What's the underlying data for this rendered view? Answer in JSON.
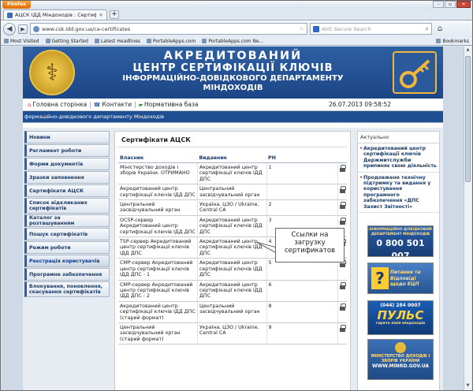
{
  "browser": {
    "menu_label": "Firefox",
    "tab_title": "АЦСК ІДД Міндоходів : Сертифікати А...",
    "tab_close": "×",
    "new_tab": "+",
    "url": "www.csk.idd.gov.ua/ca-certificates",
    "search_placeholder": "AVG Secure Search",
    "bookmarks": [
      "Most Visited",
      "Getting Started",
      "Latest Headlines",
      "PortableApps.com",
      "PortableApps.com Ne..."
    ],
    "bookmarks_menu": "Bookmarks"
  },
  "header": {
    "line1": "АКРЕДИТОВАНИЙ",
    "line2": "ЦЕНТР СЕРТИФІКАЦІЇ КЛЮЧІВ",
    "line3": "ІНФОРМАЦІЙНО-ДОВІДКОВОГО ДЕПАРТАМЕНТУ",
    "line4": "МІНДОХОДІВ"
  },
  "top_links": {
    "home": "Головна сторінка",
    "contacts": "Контакти",
    "regulatory": "Нормативна база",
    "datetime": "26.07.2013 09:58:52",
    "separator": "|"
  },
  "subbar": "формаційно-довідкового департаменту Міндоходів",
  "left_nav": [
    {
      "label": "Новини"
    },
    {
      "label": "Регламент роботи"
    },
    {
      "label": "Форми документів"
    },
    {
      "label": "Зразки заповнення"
    },
    {
      "label": "Сертифікати АЦСК"
    },
    {
      "label": "Список відкликаних сертифікатів"
    },
    {
      "label": "Каталог за розташуванням"
    },
    {
      "label": "Пошук сертифікатів"
    },
    {
      "label": "Режим роботи"
    },
    {
      "label": "Реєстрація користувачів"
    },
    {
      "label": "Програмне забезпечення"
    },
    {
      "label": "Блокування, поновлення, скасування сертифікатів"
    }
  ],
  "content": {
    "title": "Сертифікати АЦСК",
    "headers": [
      "Власник",
      "Видавник",
      "РН"
    ],
    "rows": [
      {
        "owner": "Міністерство доходів і зборів України. ОТРИМАНО",
        "issuer": "Акредитований центр сертифікації ключів ІДД ДПС",
        "rn": "1"
      },
      {
        "owner": "Акредитований центр сертифікації ключів ІДД ДПС",
        "issuer": "Центральний засвідчувальний орган",
        "rn": ""
      },
      {
        "owner": "Центральний засвідчувальний орган",
        "issuer": "Україна, ЦЗО / Ukraine, Central CA",
        "rn": "2"
      },
      {
        "owner": "OCSP-сервер Акредитований центр сертифікації ключів ІДД ДПС",
        "issuer": "Акредитований центр сертифікації ключів ІДД ДПС",
        "rn": "3"
      },
      {
        "owner": "TSP-сервер Акредитований центр сертифікації ключів ІДД ДПС",
        "issuer": "Акредитований центр сертифікації ключів ІДД ДПС",
        "rn": "4"
      },
      {
        "owner": "CMP-сервер Акредитований центр сертифікації ключів ІДД ДПС - 1",
        "issuer": "Акредитований центр сертифікації ключів ІДД ДПС",
        "rn": "5"
      },
      {
        "owner": "CMP-сервер Акредитований центр сертифікації ключів ІДД ДПС - 2",
        "issuer": "Акредитований центр сертифікації ключів ІДД ДПС",
        "rn": "6"
      },
      {
        "owner": "Акредитований центр сертифікації ключів ІДД ДПС (старий формат)",
        "issuer": "Центральний засвідчувальний орган",
        "rn": "8"
      },
      {
        "owner": "Центральний засвідчувальний орган (старий формат)",
        "issuer": "Україна, ЦЗО / Ukraine, Central CA",
        "rn": "9"
      }
    ]
  },
  "callout": "Ссылки на загрузку сертификатов",
  "right": {
    "heading": "Актуально",
    "news": [
      "Акредитований центр сертифікації ключів Держмитслужби припиняє свою діяльність",
      "Продовжено технічну підтримку та видання у користування програмного забезпечення «ДПС Захист Звітності»"
    ]
  },
  "promos": {
    "hotline_caption": "ІНФОРМАЦІЙНО-ДОВІДКОВИЙ ДЕПАРТАМЕНТ МІНДОХОДІВ",
    "hotline_number": "0 800 501 007",
    "faq_q": "?",
    "faq_text": "Питання та Відповіді щодо ЕЦП",
    "pulse_phone": "(044) 284 0007",
    "pulse_title": "ПУЛЬС",
    "pulse_caption": "гаряча лінія міндоходів",
    "ministry_text": "МІНІСТЕРСТВО ДОХОДІВ І ЗБОРІВ УКРАЇНИ",
    "ministry_url": "WWW.MINRD.GOV.UA"
  },
  "colors": {
    "banner": "#1c4686",
    "accent_gold": "#f3b63a",
    "nav_text": "#1b3a66"
  }
}
